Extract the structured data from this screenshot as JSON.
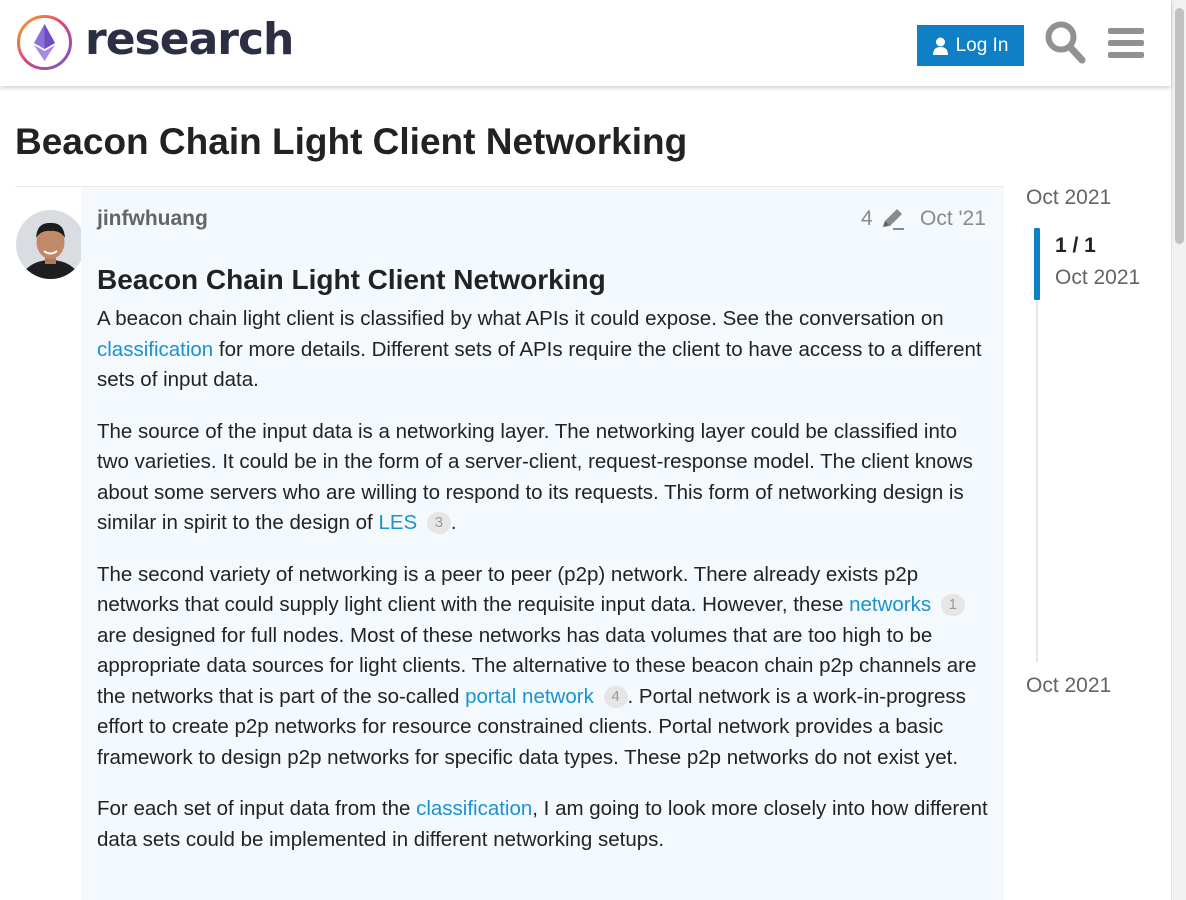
{
  "header": {
    "logo_text": "research",
    "login_label": "Log In",
    "icons": [
      "user-icon",
      "search-icon",
      "hamburger-menu-icon"
    ]
  },
  "topic": {
    "title": "Beacon Chain Light Client Networking"
  },
  "post": {
    "username": "jinfwhuang",
    "edit_count": "4",
    "date": "Oct '21",
    "heading": "Beacon Chain Light Client Networking",
    "p1": {
      "t1": "A beacon chain light client is classified by what APIs it could expose. See the conversation on ",
      "link1": "classification",
      "t2": " for more details. Different sets of APIs require the client to have access to a different sets of input data."
    },
    "p2": {
      "t1": "The source of the input data is a networking layer. The networking layer could be classified into two varieties. It could be in the form of a server-client, request-response model. The client knows about some servers who are willing to respond to its requests. This form of networking design is similar in spirit to the design of ",
      "link1": "LES",
      "badge1": "3",
      "t2": "."
    },
    "p3": {
      "t1": "The second variety of networking is a peer to peer (p2p) network. There already exists p2p networks that could supply light client with the requisite input data. However, these ",
      "link1": "networks",
      "badge1": "1",
      "t2": " are designed for full nodes. Most of these networks has data volumes that are too high to be appropriate data sources for light clients. The alternative to these beacon chain p2p channels are the networks that is part of the so-called ",
      "link2": "portal network",
      "badge2": "4",
      "t3": ". Portal network is a work-in-progress effort to create p2p networks for resource constrained clients. Portal network provides a basic framework to design p2p networks for specific data types. These p2p networks do not exist yet."
    },
    "p4": {
      "t1": "For each set of input data from the ",
      "link1": "classification",
      "t2": ", I am going to look more closely into how different data sets could be implemented in different networking setups."
    }
  },
  "timeline": {
    "top_date": "Oct 2021",
    "position": "1 / 1",
    "current_date": "Oct 2021",
    "bottom_date": "Oct 2021"
  },
  "colors": {
    "accent": "#0f7fc6",
    "link": "#1a92d0",
    "post_bg": "#f4f9fd"
  }
}
